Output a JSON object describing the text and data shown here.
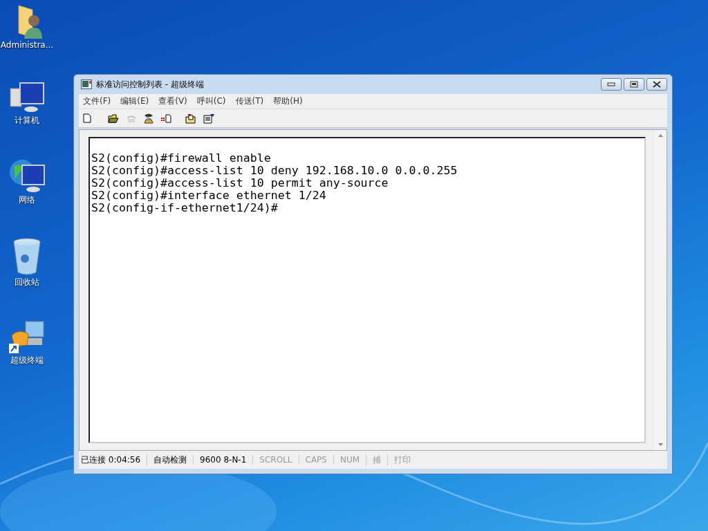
{
  "desktop_icons": [
    {
      "label": "Administra...",
      "kind": "user-folder"
    },
    {
      "label": "计算机",
      "kind": "computer"
    },
    {
      "label": "网络",
      "kind": "network"
    },
    {
      "label": "回收站",
      "kind": "recycle-bin"
    },
    {
      "label": "超级终端",
      "kind": "terminal"
    }
  ],
  "window": {
    "title": "标准访问控制列表 - 超级终端"
  },
  "menu": [
    "文件(F)",
    "编辑(E)",
    "查看(V)",
    "呼叫(C)",
    "传送(T)",
    "帮助(H)"
  ],
  "toolbar": [
    {
      "kind": "new",
      "disabled": false
    },
    {
      "kind": "open",
      "disabled": false
    },
    {
      "kind": "call",
      "disabled": true
    },
    {
      "kind": "hangup",
      "disabled": false
    },
    {
      "kind": "send",
      "disabled": false
    },
    {
      "kind": "receive",
      "disabled": false
    },
    {
      "kind": "properties",
      "disabled": false
    }
  ],
  "terminal_lines": [
    "S2(config)#firewall enable",
    "S2(config)#access-list 10 deny 192.168.10.0 0.0.0.255",
    "S2(config)#access-list 10 permit any-source",
    "S2(config)#interface ethernet 1/24",
    "S2(config-if-ethernet1/24)#"
  ],
  "status_bar": [
    {
      "text": "已连接 0:04:56",
      "disabled": false
    },
    {
      "text": "自动检测",
      "disabled": false
    },
    {
      "text": "9600 8-N-1",
      "disabled": false
    },
    {
      "text": "SCROLL",
      "disabled": true
    },
    {
      "text": "CAPS",
      "disabled": true
    },
    {
      "text": "NUM",
      "disabled": true
    },
    {
      "text": "捕",
      "disabled": true
    },
    {
      "text": "打印",
      "disabled": true
    }
  ]
}
